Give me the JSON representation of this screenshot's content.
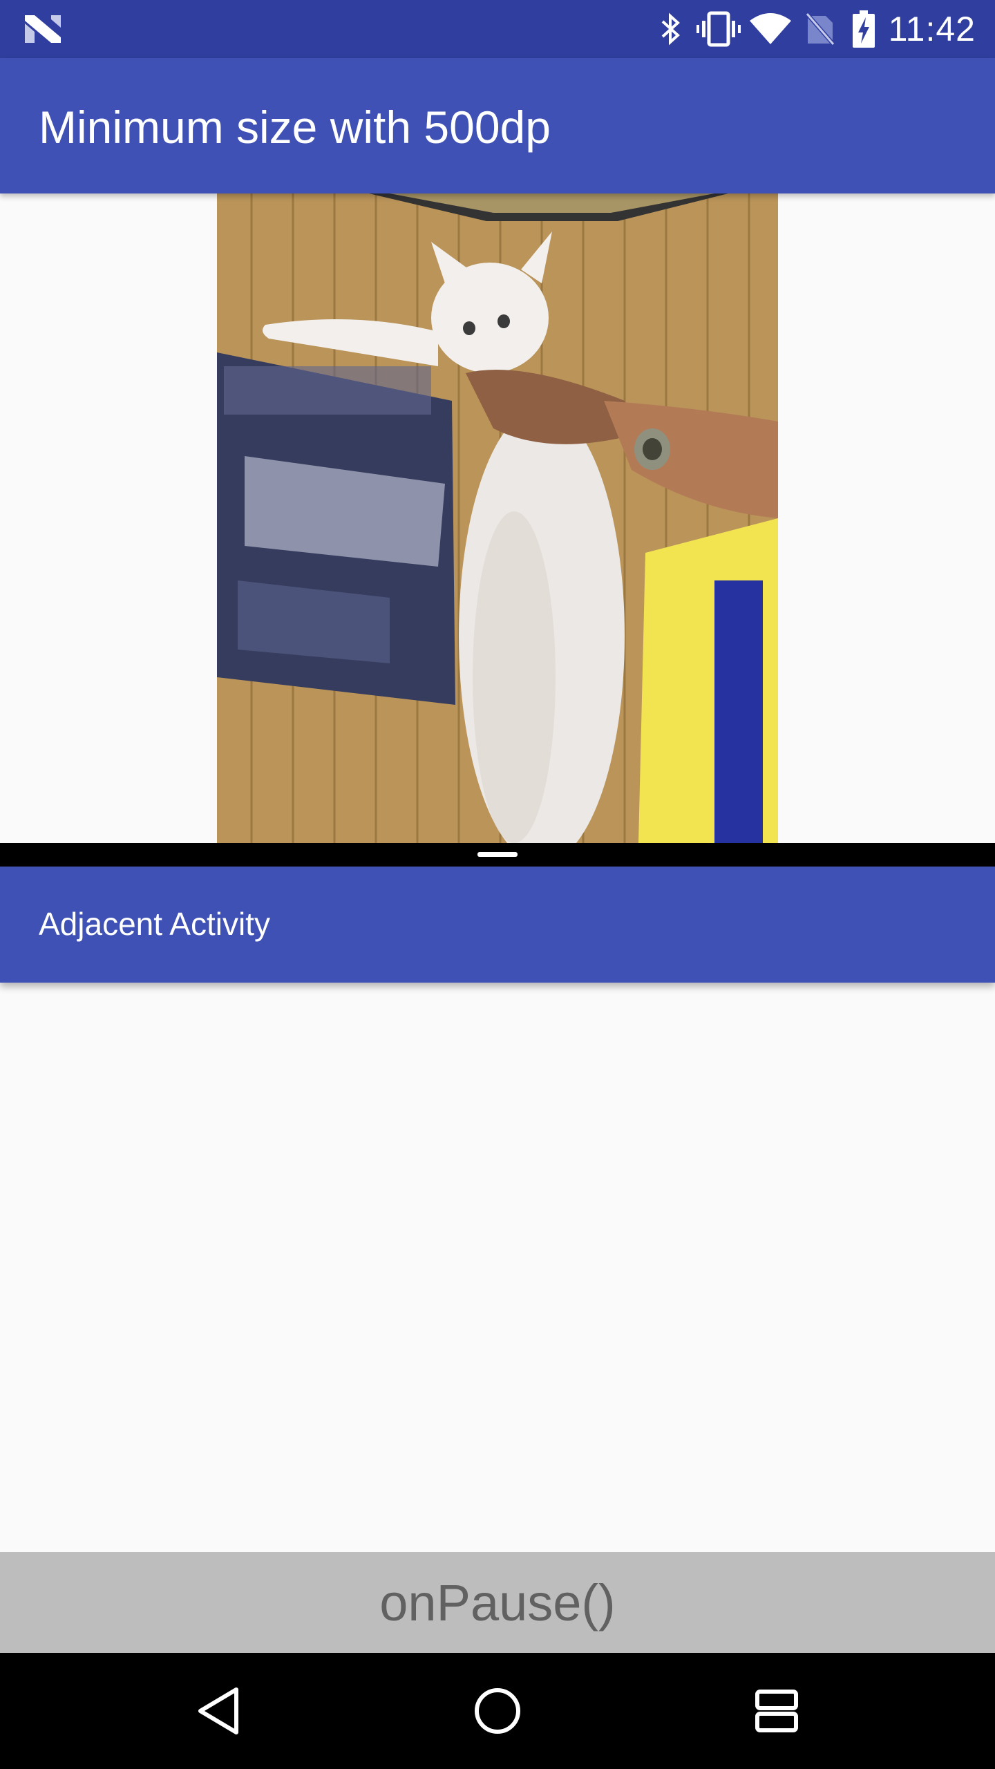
{
  "status_bar": {
    "time": "11:42",
    "icons": [
      "n-logo-icon",
      "bluetooth-icon",
      "vibrate-icon",
      "wifi-icon",
      "no-sim-icon",
      "battery-charging-icon"
    ]
  },
  "top_window": {
    "title": "Minimum size with 500dp",
    "image": "long-cat-photo"
  },
  "bottom_window": {
    "title": "Adjacent Activity"
  },
  "lifecycle_label": "onPause()",
  "nav_bar": {
    "buttons": [
      "back-icon",
      "home-icon",
      "recents-icon"
    ]
  },
  "colors": {
    "status_bar": "#303f9f",
    "app_bar": "#3f51b5",
    "background": "#fafafa",
    "lifecycle_bar": "#bdbdbd",
    "lifecycle_text": "#616161",
    "nav_bar": "#000000"
  }
}
